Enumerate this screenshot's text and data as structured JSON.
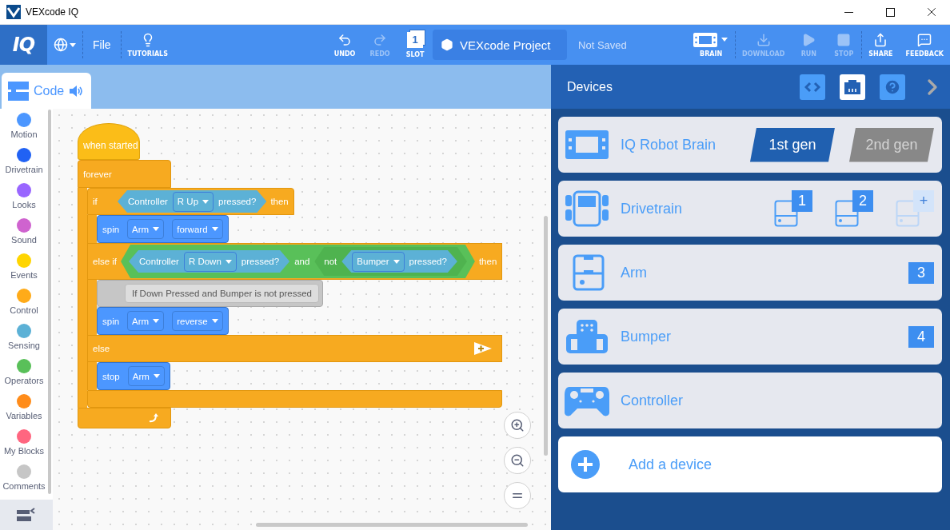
{
  "window": {
    "title": "VEXcode IQ"
  },
  "toolbar": {
    "logo": "IQ",
    "file_menu": "File",
    "tools": [
      {
        "kind": "tutorials",
        "label": "TUTORIALS",
        "disabled": false,
        "separator_before": true
      },
      {
        "kind": "undo",
        "label": "UNDO",
        "disabled": false,
        "separator_before": false
      },
      {
        "kind": "redo",
        "label": "REDO",
        "disabled": true,
        "separator_before": false
      },
      {
        "kind": "slot",
        "label": "SLOT",
        "number": "1",
        "disabled": false,
        "separator_before": false
      }
    ],
    "project": {
      "name": "VEXcode Project",
      "status": "Not Saved"
    },
    "actions": [
      {
        "kind": "brain",
        "label": "BRAIN",
        "disabled": false,
        "separator_before": false
      },
      {
        "kind": "download",
        "label": "DOWNLOAD",
        "disabled": true,
        "separator_before": true
      },
      {
        "kind": "run",
        "label": "RUN",
        "disabled": true,
        "separator_before": false
      },
      {
        "kind": "stop",
        "label": "STOP",
        "disabled": true,
        "separator_before": false
      },
      {
        "kind": "share",
        "label": "SHARE",
        "disabled": false,
        "separator_before": true
      },
      {
        "kind": "feedback",
        "label": "FEEDBACK",
        "disabled": false,
        "separator_before": false
      }
    ]
  },
  "editor": {
    "tab": {
      "label": "Code"
    },
    "categories": [
      {
        "label": "Motion",
        "color": "#4c97ff"
      },
      {
        "label": "Drivetrain",
        "color": "#2162f4"
      },
      {
        "label": "Looks",
        "color": "#9966ff"
      },
      {
        "label": "Sound",
        "color": "#cf63cf"
      },
      {
        "label": "Events",
        "color": "#ffd500"
      },
      {
        "label": "Control",
        "color": "#ffab19"
      },
      {
        "label": "Sensing",
        "color": "#5cb1d6"
      },
      {
        "label": "Operators",
        "color": "#59c059"
      },
      {
        "label": "Variables",
        "color": "#ff8c1a"
      },
      {
        "label": "My Blocks",
        "color": "#ff6680"
      },
      {
        "label": "Comments",
        "color": "#c6c6c6"
      }
    ],
    "script": {
      "hat": "when started",
      "body": [
        {
          "kind": "forever",
          "label": "forever",
          "body": [
            {
              "kind": "if",
              "arms": [
                {
                  "label": "if",
                  "then": "then",
                  "condition": {
                    "kind": "pressed",
                    "device": "Controller",
                    "option": "R Up",
                    "suffix": "pressed?"
                  },
                  "body": [
                    {
                      "kind": "command",
                      "label": "spin",
                      "options": [
                        "Arm",
                        "forward"
                      ]
                    }
                  ]
                },
                {
                  "label": "else if",
                  "then": "then",
                  "condition": {
                    "kind": "and",
                    "label": "and",
                    "left": {
                      "kind": "pressed",
                      "device": "Controller",
                      "option": "R Down",
                      "suffix": "pressed?"
                    },
                    "right": {
                      "kind": "not",
                      "label": "not",
                      "operand": {
                        "kind": "pressed",
                        "option": "Bumper",
                        "suffix": "pressed?"
                      }
                    }
                  },
                  "body": [
                    {
                      "kind": "comment",
                      "text": "If Down Pressed and Bumper is not pressed"
                    },
                    {
                      "kind": "command",
                      "label": "spin",
                      "options": [
                        "Arm",
                        "reverse"
                      ]
                    }
                  ]
                },
                {
                  "label": "else",
                  "expandable": true,
                  "body": [
                    {
                      "kind": "command",
                      "label": "stop",
                      "options": [
                        "Arm"
                      ]
                    }
                  ]
                }
              ]
            }
          ]
        }
      ]
    }
  },
  "devices_panel": {
    "title": "Devices",
    "views": [
      {
        "kind": "code",
        "selected": false
      },
      {
        "kind": "devices",
        "selected": true
      },
      {
        "kind": "help",
        "selected": false
      }
    ],
    "devices": [
      {
        "kind": "brain",
        "name": "IQ Robot Brain",
        "generations": [
          {
            "label": "1st gen",
            "selected": true
          },
          {
            "label": "2nd gen",
            "selected": false
          }
        ]
      },
      {
        "kind": "drivetrain",
        "name": "Drivetrain",
        "ports": [
          {
            "label": "1",
            "faded": false
          },
          {
            "label": "2",
            "faded": false
          },
          {
            "label": "+",
            "faded": true
          }
        ]
      },
      {
        "kind": "arm",
        "name": "Arm",
        "ports": [
          {
            "label": "3",
            "faded": false
          }
        ]
      },
      {
        "kind": "bumper",
        "name": "Bumper",
        "ports": [
          {
            "label": "4",
            "faded": false
          }
        ]
      },
      {
        "kind": "controller",
        "name": "Controller"
      }
    ],
    "add_label": "Add a device"
  }
}
